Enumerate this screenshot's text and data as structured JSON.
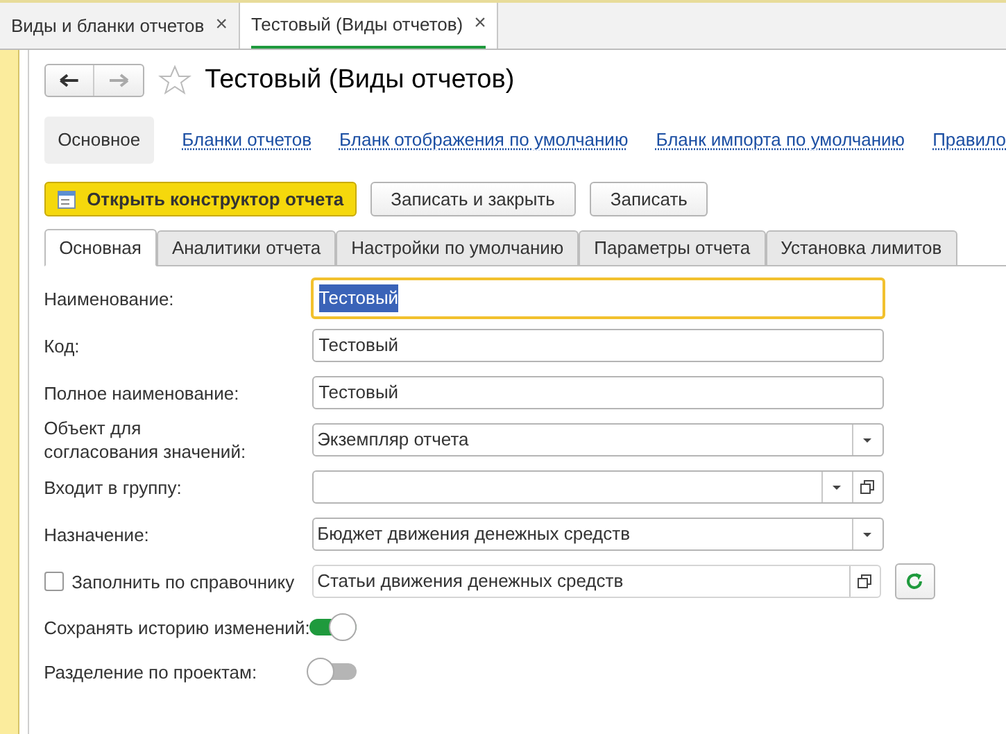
{
  "window_tabs": [
    {
      "label": "Виды и бланки отчетов",
      "close": "×",
      "selected": false
    },
    {
      "label": "Тестовый (Виды отчетов)",
      "close": "×",
      "selected": true
    }
  ],
  "title": "Тестовый (Виды отчетов)",
  "nav_links": [
    {
      "label": "Основное",
      "selected": true
    },
    {
      "label": "Бланки отчетов",
      "selected": false
    },
    {
      "label": "Бланк отображения по умолчанию",
      "selected": false
    },
    {
      "label": "Бланк импорта по умолчанию",
      "selected": false
    },
    {
      "label": "Правило",
      "selected": false
    }
  ],
  "buttons": [
    {
      "label": "Открыть конструктор отчета",
      "kind": "primary"
    },
    {
      "label": "Записать и закрыть",
      "kind": "default"
    },
    {
      "label": "Записать",
      "kind": "default"
    }
  ],
  "tabs": [
    {
      "label": "Основная",
      "selected": true
    },
    {
      "label": "Аналитики отчета",
      "selected": false
    },
    {
      "label": "Настройки по умолчанию",
      "selected": false
    },
    {
      "label": "Параметры отчета",
      "selected": false
    },
    {
      "label": "Установка лимитов",
      "selected": false
    }
  ],
  "fields": [
    {
      "kind": "text",
      "label": "Наименование:",
      "value": "Тестовый",
      "focused": true
    },
    {
      "kind": "text",
      "label": "Код:",
      "value": "Тестовый",
      "focused": false
    },
    {
      "kind": "text",
      "label": "Полное наименование:",
      "value": "Тестовый",
      "focused": false
    },
    {
      "kind": "select",
      "label": "Объект для согласования значений:",
      "value": "Экземпляр отчета"
    },
    {
      "kind": "select_open",
      "label": "Входит в группу:"
    },
    {
      "kind": "select",
      "label": "Назначение:",
      "value": "Бюджет движения денежных средств"
    },
    {
      "kind": "check_ref",
      "label": "Заполнить по справочнику",
      "checked": false,
      "value": "Статьи движения денежных средств"
    },
    {
      "kind": "toggle",
      "label": "Сохранять историю изменений:",
      "on": true
    },
    {
      "kind": "toggle",
      "label": "Разделение по проектам:",
      "on": false
    }
  ]
}
